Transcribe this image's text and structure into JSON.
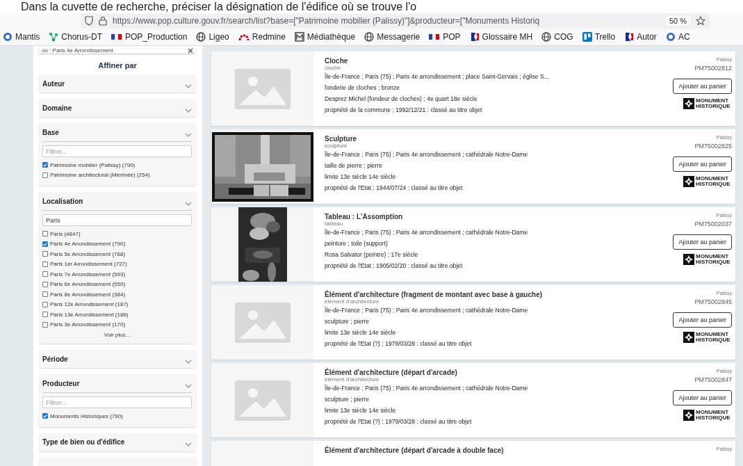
{
  "caption": "Dans la cuvette de recherche, préciser la désignation de l'édifice où se trouve l'o",
  "browser": {
    "url": "https://www.pop.culture.gouv.fr/search/list?base=[\"Patrimoine mobilier (Palissy)\"]&producteur=[\"Monuments Historiq",
    "zoom": "50 %"
  },
  "bookmarks": [
    {
      "label": "Mantis",
      "kind": "circle"
    },
    {
      "label": "Chorus-DT",
      "kind": "network"
    },
    {
      "label": "POP_Production",
      "kind": "flag"
    },
    {
      "label": "Ligeo",
      "kind": "globe"
    },
    {
      "label": "Redmine",
      "kind": "arc"
    },
    {
      "label": "Médiathèque",
      "kind": "square"
    },
    {
      "label": "Messagerie",
      "kind": "globe"
    },
    {
      "label": "POP",
      "kind": "flag"
    },
    {
      "label": "Glossaire MH",
      "kind": "marianne"
    },
    {
      "label": "COG",
      "kind": "globe"
    },
    {
      "label": "Trello",
      "kind": "board"
    },
    {
      "label": "Autor",
      "kind": "marianne"
    },
    {
      "label": "AC",
      "kind": "circle"
    }
  ],
  "sidebar": {
    "search_chip": "où : Paris 4e Arrondissement",
    "heading": "Affiner par",
    "filters": [
      {
        "title": "Auteur"
      },
      {
        "title": "Domaine"
      },
      {
        "title": "Base",
        "placeholder": "Filtrer...",
        "options": [
          {
            "label": "Patrimoine mobilier (Palissy) (790)",
            "checked": true
          },
          {
            "label": "Patrimoine architectural (Mérimée) (254)",
            "checked": false
          }
        ]
      },
      {
        "title": "Localisation",
        "value": "Paris",
        "options": [
          {
            "label": "Paris (4847)",
            "checked": false
          },
          {
            "label": "Paris 4e Arrondissement (790)",
            "checked": true
          },
          {
            "label": "Paris 5e Arrondissement (768)",
            "checked": false
          },
          {
            "label": "Paris 1er Arrondissement (727)",
            "checked": false
          },
          {
            "label": "Paris 7e Arrondissement (593)",
            "checked": false
          },
          {
            "label": "Paris 6e Arrondissement (550)",
            "checked": false
          },
          {
            "label": "Paris 8e Arrondissement (384)",
            "checked": false
          },
          {
            "label": "Paris 12e Arrondissement (187)",
            "checked": false
          },
          {
            "label": "Paris 13e Arrondissement (186)",
            "checked": false
          },
          {
            "label": "Paris 3e Arrondissement (170)",
            "checked": false
          }
        ],
        "more": "Voir plus..."
      },
      {
        "title": "Période"
      },
      {
        "title": "Producteur",
        "placeholder": "Filtrer...",
        "options": [
          {
            "label": "Monuments Historiques (790)",
            "checked": true
          }
        ]
      },
      {
        "title": "Type de bien ou d'édifice"
      }
    ]
  },
  "results": [
    {
      "kind": "placeholder",
      "title": "Cloche",
      "subtitle": "cloche",
      "lines": [
        "Île-de-France ; Paris (75) ; Paris 4e arrondissement ; place Saint-Gervais ; église S...",
        "fonderie de cloches ; bronze",
        "Desprez Michel (fondeur de cloches) ; 4e quart 18e siècle",
        "propriété de la commune ; 1992/12/21 : classé au titre objet"
      ],
      "source": "Palissy",
      "reference": "PM75002812",
      "button": "Ajouter au panier",
      "badge": "MONUMENT HISTORIQUE"
    },
    {
      "title": "Sculpture",
      "subtitle": "sculpture",
      "lines": [
        "Île-de-France ; Paris (75) ; Paris 4e arrondissement ; cathédrale Notre-Dame",
        "taille de pierre ; pierre",
        "limite 13e siècle 14e siècle",
        "propriété de l'Etat ; 1944/07/24 : classé au titre objet"
      ],
      "source": "Palissy",
      "reference": "PM75002825",
      "button": "Ajouter au panier",
      "badge": "MONUMENT HISTORIQUE"
    },
    {
      "kind": "painting",
      "title": "Tableau : L'Assomption",
      "subtitle": "tableau",
      "lines": [
        "Île-de-France ; Paris (75) ; Paris 4e arrondissement ; cathédrale Notre-Dame",
        "peinture ; toile (support)",
        "Rosa Salvator (peintre) ; 17e siècle",
        "propriété de l'Etat ; 1905/02/20 : classé au titre objet"
      ],
      "source": "Palissy",
      "reference": "PM75002037",
      "button": "Ajouter au panier",
      "badge": "MONUMENT HISTORIQUE"
    },
    {
      "kind": "placeholder",
      "title": "Élément d'architecture (fragment de montant avec base à gauche)",
      "subtitle": "élément d'architecture",
      "lines": [
        "Île-de-France ; Paris (75) ; Paris 4e arrondissement ; cathédrale Notre-Dame",
        "sculpture ; pierre",
        "limite 13e siècle 14e siècle",
        "propriété de l'Etat (?) ; 1979/03/28 : classé au titre objet"
      ],
      "source": "Palissy",
      "reference": "PM75002845",
      "button": "Ajouter au panier",
      "badge": "MONUMENT HISTORIQUE"
    },
    {
      "kind": "placeholder",
      "title": "Élément d'architecture (départ d'arcade)",
      "subtitle": "élément d'architecture",
      "lines": [
        "Île-de-France ; Paris (75) ; Paris 4e arrondissement ; cathédrale Notre-Dame",
        "sculpture ; pierre",
        "limite 13e siècle 14e siècle",
        "propriété de l'Etat (?) ; 1979/03/28 : classé au titre objet"
      ],
      "source": "Palissy",
      "reference": "PM75002847",
      "button": "Ajouter au panier",
      "badge": "MONUMENT HISTORIQUE"
    },
    {
      "title": "Élément d'architecture (départ d'arcade à double face)",
      "source": "Palissy"
    }
  ]
}
